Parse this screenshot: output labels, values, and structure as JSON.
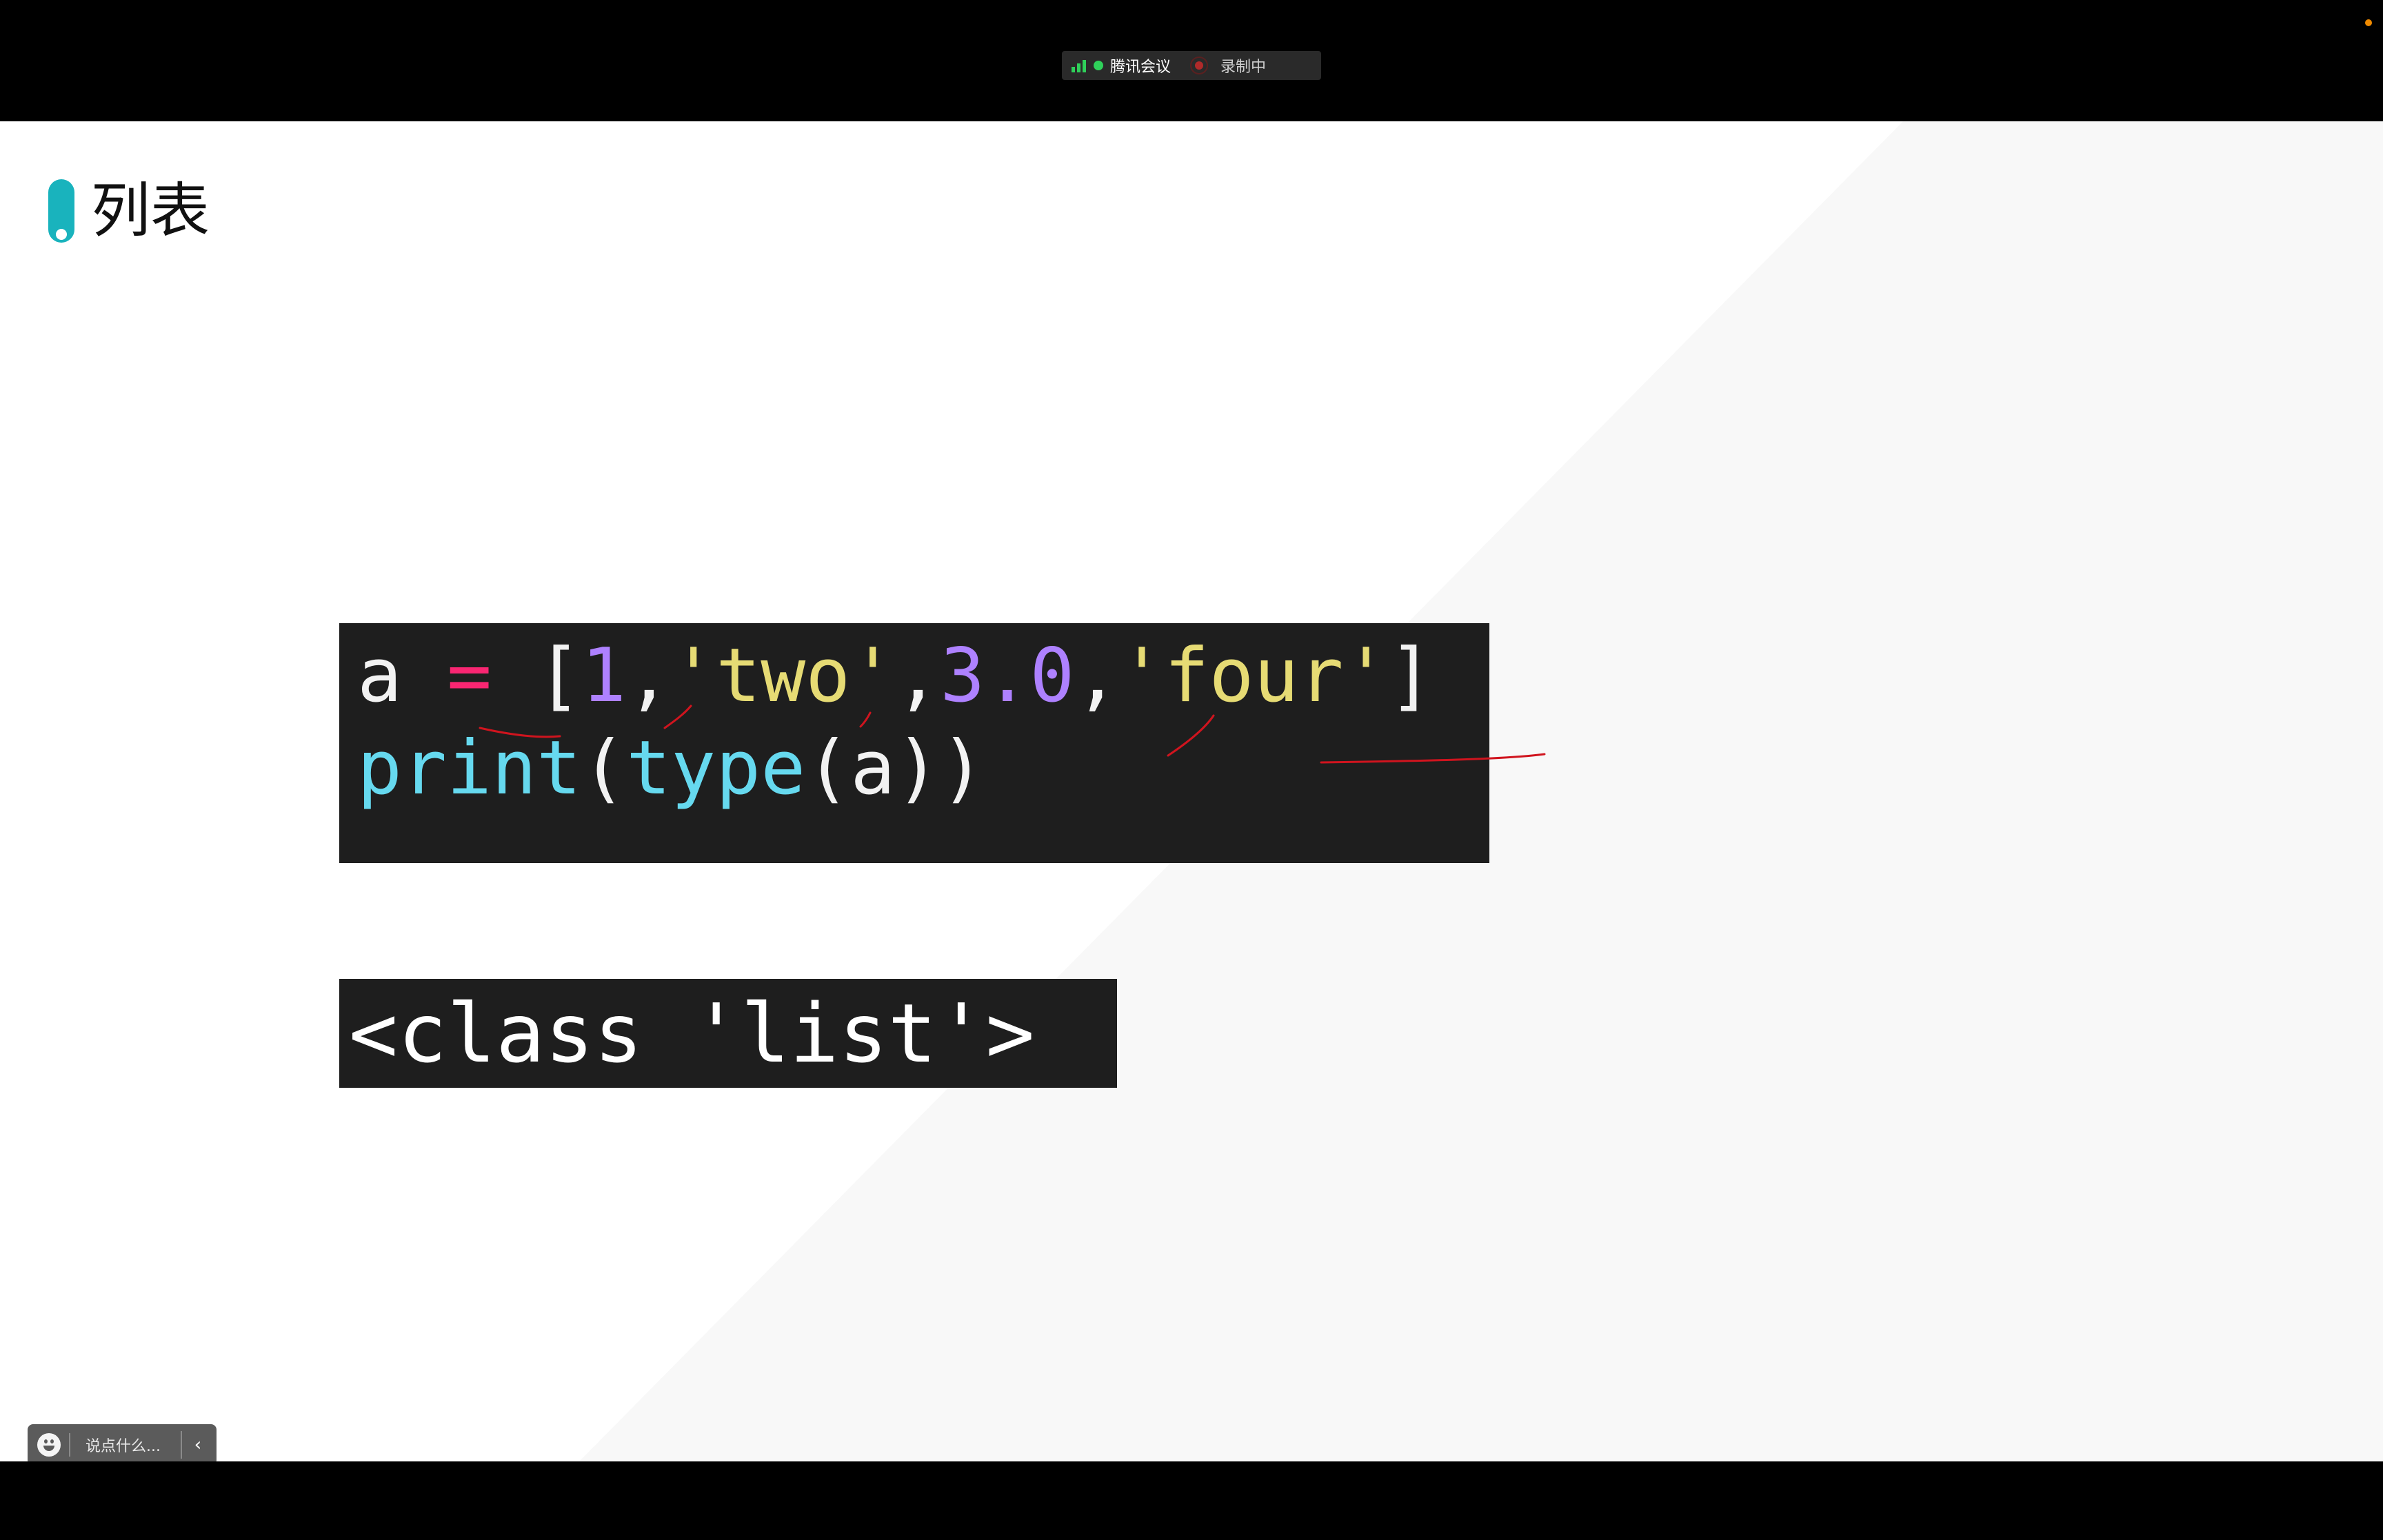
{
  "meeting_bar": {
    "app_name": "腾讯会议",
    "recording_label": "录制中",
    "signal_color": "#2fd05a",
    "recording_color": "#b02a2a"
  },
  "slide": {
    "title": "列表",
    "accent_color": "#19b3bd",
    "code": {
      "line1": {
        "var": "a",
        "eq": "=",
        "open": "[",
        "num1": "1",
        "comma1": ",",
        "str1": "'two'",
        "comma2": ",",
        "num2": "3.0",
        "comma3": ",",
        "str2": "'four'",
        "close": "]"
      },
      "line2": {
        "fn1": "print",
        "p1": "(",
        "fn2": "type",
        "p2": "(",
        "arg": "a",
        "p3": "))"
      }
    },
    "output": "<class 'list'>"
  },
  "chat": {
    "placeholder": "说点什么...",
    "emoji_icon": "smiley-icon",
    "collapse_icon": "chevron-left-icon"
  },
  "annotation_color": "#d0141e"
}
